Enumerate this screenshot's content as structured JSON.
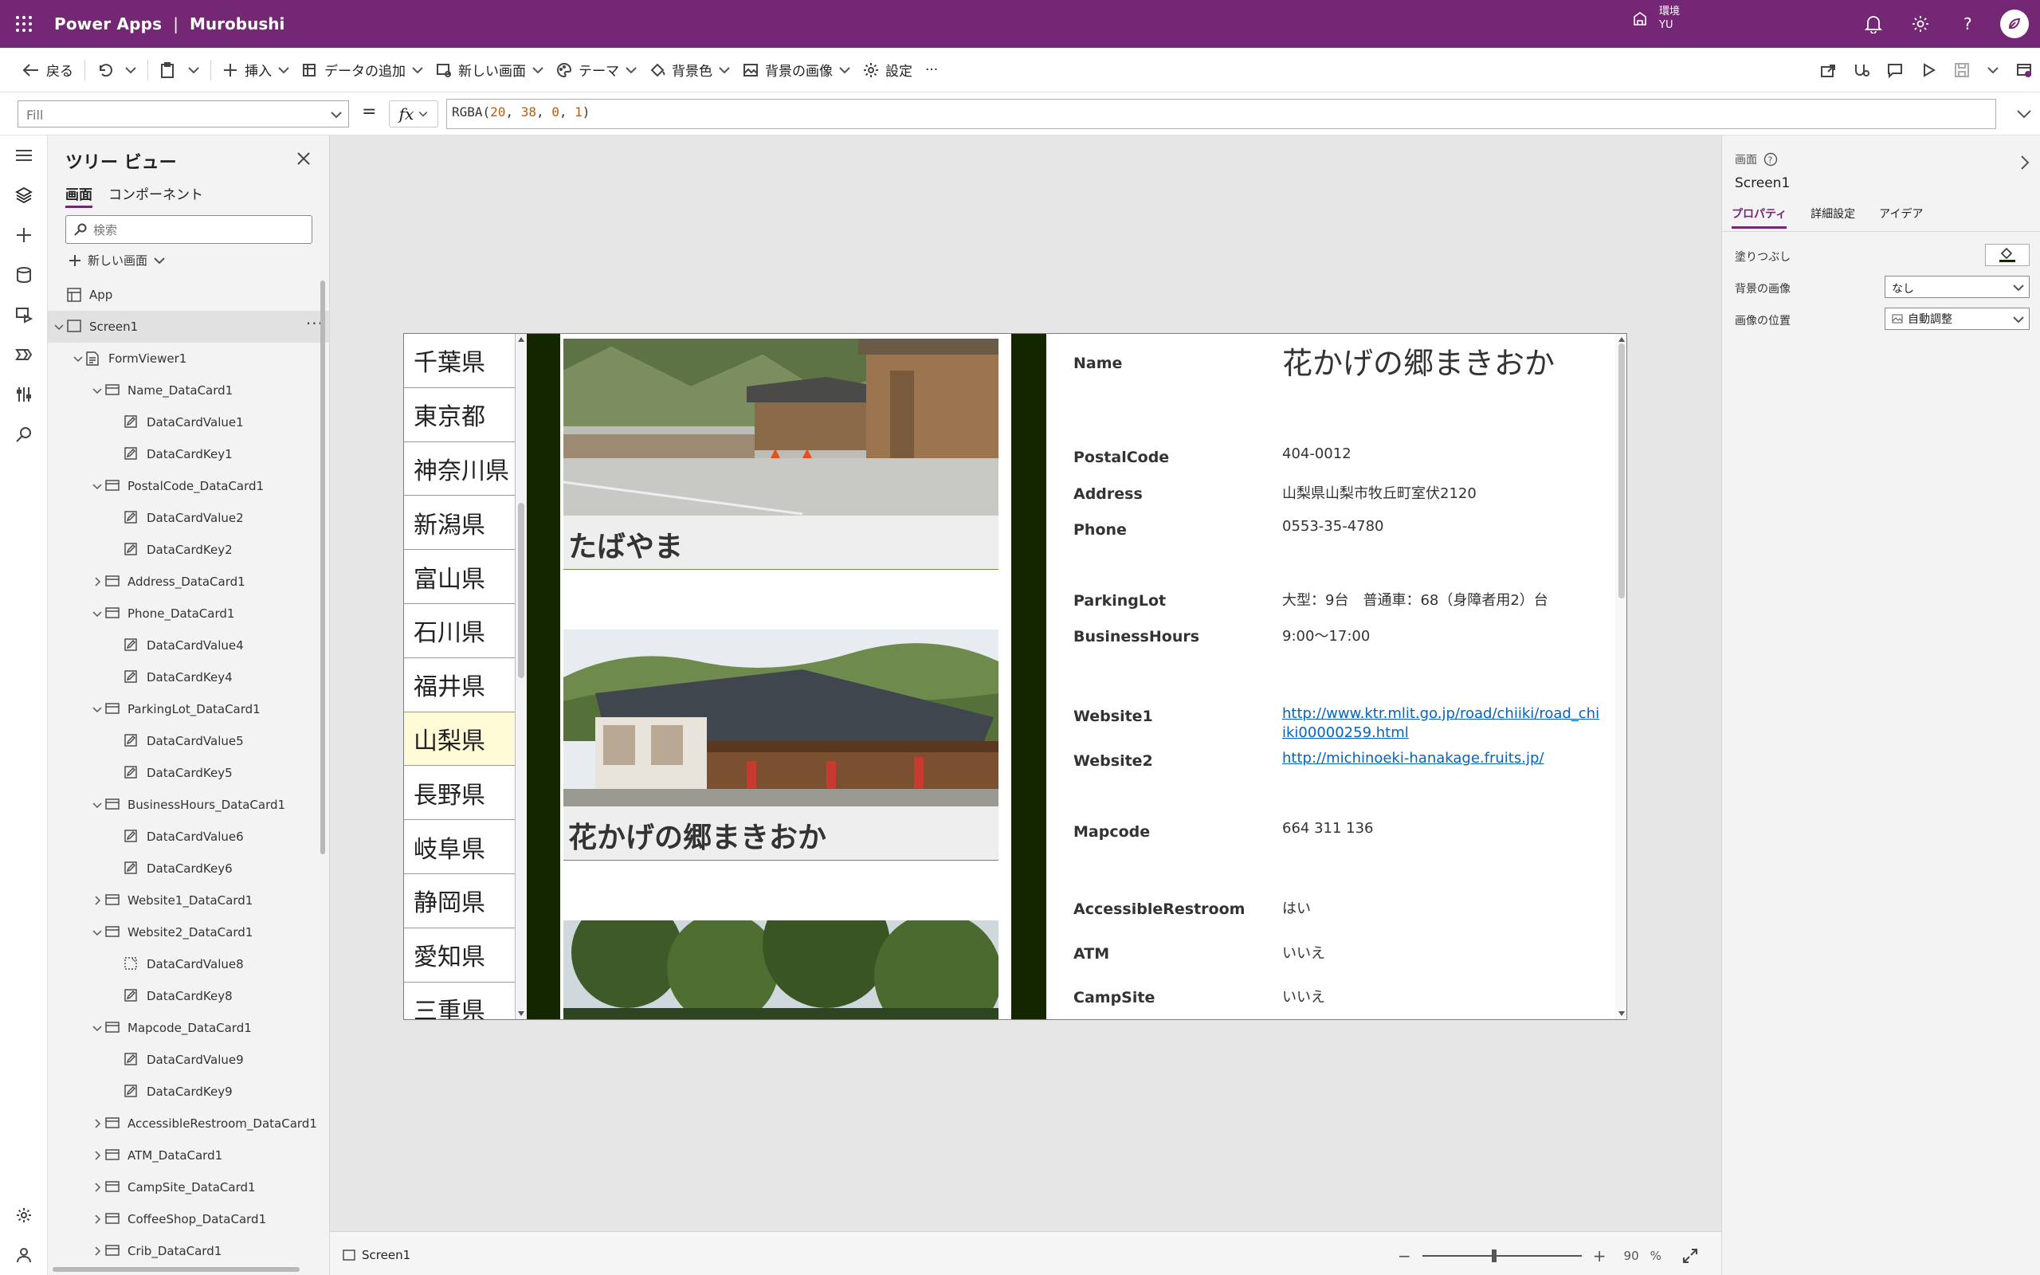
{
  "topbar": {
    "product": "Power Apps",
    "separator": "|",
    "app_name": "Murobushi",
    "env_label": "環境",
    "env_name": "YU"
  },
  "commands": {
    "back": "戻る",
    "insert": "挿入",
    "add_data": "データの追加",
    "new_screen": "新しい画面",
    "theme": "テーマ",
    "bg_color": "背景色",
    "bg_image": "背景の画像",
    "settings": "設定",
    "more": "···"
  },
  "formula": {
    "property": "Fill",
    "equals": "=",
    "fx": "fx",
    "fn": "RGBA(",
    "args": [
      "20",
      "38",
      "0",
      "1"
    ],
    "close": ")"
  },
  "tree": {
    "title": "ツリー ビュー",
    "tabs": [
      "画面",
      "コンポーネント"
    ],
    "search_placeholder": "検索",
    "new_screen": "新しい画面",
    "items": [
      {
        "label": "App",
        "depth": 0,
        "icon": "app-icon",
        "chevron": "none"
      },
      {
        "label": "Screen1",
        "depth": 0,
        "icon": "screen-icon",
        "chevron": "down",
        "selected": true
      },
      {
        "label": "FormViewer1",
        "depth": 1,
        "icon": "form-icon",
        "chevron": "down"
      },
      {
        "label": "Name_DataCard1",
        "depth": 2,
        "icon": "card-icon",
        "chevron": "down"
      },
      {
        "label": "DataCardValue1",
        "depth": 3,
        "icon": "edit-icon",
        "chevron": "none"
      },
      {
        "label": "DataCardKey1",
        "depth": 3,
        "icon": "edit-icon",
        "chevron": "none"
      },
      {
        "label": "PostalCode_DataCard1",
        "depth": 2,
        "icon": "card-icon",
        "chevron": "down"
      },
      {
        "label": "DataCardValue2",
        "depth": 3,
        "icon": "edit-icon",
        "chevron": "none"
      },
      {
        "label": "DataCardKey2",
        "depth": 3,
        "icon": "edit-icon",
        "chevron": "none"
      },
      {
        "label": "Address_DataCard1",
        "depth": 2,
        "icon": "card-icon",
        "chevron": "right"
      },
      {
        "label": "Phone_DataCard1",
        "depth": 2,
        "icon": "card-icon",
        "chevron": "down"
      },
      {
        "label": "DataCardValue4",
        "depth": 3,
        "icon": "edit-icon",
        "chevron": "none"
      },
      {
        "label": "DataCardKey4",
        "depth": 3,
        "icon": "edit-icon",
        "chevron": "none"
      },
      {
        "label": "ParkingLot_DataCard1",
        "depth": 2,
        "icon": "card-icon",
        "chevron": "down"
      },
      {
        "label": "DataCardValue5",
        "depth": 3,
        "icon": "edit-icon",
        "chevron": "none"
      },
      {
        "label": "DataCardKey5",
        "depth": 3,
        "icon": "edit-icon",
        "chevron": "none"
      },
      {
        "label": "BusinessHours_DataCard1",
        "depth": 2,
        "icon": "card-icon",
        "chevron": "down"
      },
      {
        "label": "DataCardValue6",
        "depth": 3,
        "icon": "edit-icon",
        "chevron": "none"
      },
      {
        "label": "DataCardKey6",
        "depth": 3,
        "icon": "edit-icon",
        "chevron": "none"
      },
      {
        "label": "Website1_DataCard1",
        "depth": 2,
        "icon": "card-icon",
        "chevron": "right"
      },
      {
        "label": "Website2_DataCard1",
        "depth": 2,
        "icon": "card-icon",
        "chevron": "down"
      },
      {
        "label": "DataCardValue8",
        "depth": 3,
        "icon": "link-icon",
        "chevron": "none"
      },
      {
        "label": "DataCardKey8",
        "depth": 3,
        "icon": "edit-icon",
        "chevron": "none"
      },
      {
        "label": "Mapcode_DataCard1",
        "depth": 2,
        "icon": "card-icon",
        "chevron": "down"
      },
      {
        "label": "DataCardValue9",
        "depth": 3,
        "icon": "edit-icon",
        "chevron": "none"
      },
      {
        "label": "DataCardKey9",
        "depth": 3,
        "icon": "edit-icon",
        "chevron": "none"
      },
      {
        "label": "AccessibleRestroom_DataCard1",
        "depth": 2,
        "icon": "card-icon",
        "chevron": "right"
      },
      {
        "label": "ATM_DataCard1",
        "depth": 2,
        "icon": "card-icon",
        "chevron": "right"
      },
      {
        "label": "CampSite_DataCard1",
        "depth": 2,
        "icon": "card-icon",
        "chevron": "right"
      },
      {
        "label": "CoffeeShop_DataCard1",
        "depth": 2,
        "icon": "card-icon",
        "chevron": "right"
      },
      {
        "label": "Crib_DataCard1",
        "depth": 2,
        "icon": "card-icon",
        "chevron": "right"
      }
    ]
  },
  "prefectures": {
    "items": [
      "千葉県",
      "東京都",
      "神奈川県",
      "新潟県",
      "富山県",
      "石川県",
      "福井県",
      "山梨県",
      "長野県",
      "岐阜県",
      "静岡県",
      "愛知県",
      "三重県"
    ],
    "selected": "山梨県"
  },
  "gallery": {
    "cards": [
      "たばやま",
      "花かげの郷まきおか",
      ""
    ]
  },
  "detail": {
    "fields": [
      {
        "key": "Name",
        "value": "花かげの郷まきおか",
        "style": "title"
      },
      {
        "key": "PostalCode",
        "value": "404-0012",
        "style": "text"
      },
      {
        "key": "Address",
        "value": "山梨県山梨市牧丘町室伏2120",
        "style": "text"
      },
      {
        "key": "Phone",
        "value": "0553-35-4780",
        "style": "text"
      },
      {
        "key": "ParkingLot",
        "value": "大型：9台　普通車：68（身障者用2）台",
        "style": "text"
      },
      {
        "key": "BusinessHours",
        "value": "9:00～17:00",
        "style": "text"
      },
      {
        "key": "Website1",
        "value": "http://www.ktr.mlit.go.jp/road/chiiki/road_chiiki00000259.html",
        "style": "link"
      },
      {
        "key": "Website2",
        "value": "http://michinoeki-hanakage.fruits.jp/",
        "style": "link"
      },
      {
        "key": "Mapcode",
        "value": "664 311 136",
        "style": "text"
      },
      {
        "key": "AccessibleRestroom",
        "value": "はい",
        "style": "text"
      },
      {
        "key": "ATM",
        "value": "いいえ",
        "style": "text"
      },
      {
        "key": "CampSite",
        "value": "いいえ",
        "style": "text"
      }
    ]
  },
  "statusbar": {
    "screen": "Screen1",
    "zoom_minus": "−",
    "zoom_plus": "+",
    "zoom": "90",
    "zoom_unit": "%",
    "zoom_fraction": 0.45
  },
  "props": {
    "type_label": "画面",
    "name": "Screen1",
    "tabs": [
      "プロパティ",
      "詳細設定",
      "アイデア"
    ],
    "fill_label": "塗りつぶし",
    "bg_image_label": "背景の画像",
    "bg_image_value": "なし",
    "image_pos_label": "画像の位置",
    "image_pos_value": "自動調整"
  },
  "colors": {
    "brand": "#742774",
    "fill": "#142600",
    "selected_row": "#fefbd6",
    "link": "#0563c1"
  }
}
